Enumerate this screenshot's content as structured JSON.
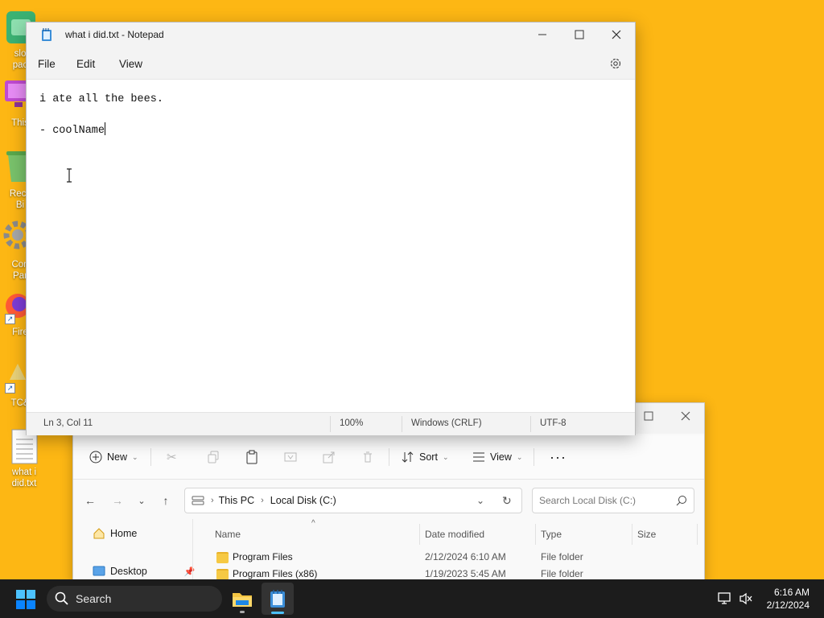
{
  "desktop": {
    "icons": [
      {
        "label": "slo\npac",
        "icon": "folder-app-icon"
      },
      {
        "label": "This",
        "icon": "this-pc-icon"
      },
      {
        "label": "Recy\nBi",
        "icon": "recycle-bin-icon"
      },
      {
        "label": "Con\nPar",
        "icon": "control-panel-icon"
      },
      {
        "label": "Fire",
        "icon": "firefox-icon"
      },
      {
        "label": "TC&",
        "icon": "shortcut-icon"
      },
      {
        "label": "what i\ndid.txt",
        "icon": "text-file-icon"
      }
    ]
  },
  "notepad": {
    "title": "what i did.txt - Notepad",
    "menu": {
      "file": "File",
      "edit": "Edit",
      "view": "View"
    },
    "content": {
      "line1": "i ate all the bees.",
      "line3": "- coolName"
    },
    "status": {
      "position": "Ln 3, Col 11",
      "zoom": "100%",
      "line_ending": "Windows (CRLF)",
      "encoding": "UTF-8"
    }
  },
  "explorer": {
    "toolbar": {
      "new": "New",
      "sort": "Sort",
      "view": "View"
    },
    "address": {
      "root": "This PC",
      "current": "Local Disk (C:)"
    },
    "search_placeholder": "Search Local Disk (C:)",
    "nav": {
      "home": "Home",
      "desktop": "Desktop"
    },
    "columns": {
      "name": "Name",
      "date": "Date modified",
      "type": "Type",
      "size": "Size"
    },
    "files": [
      {
        "name": "Program Files",
        "date": "2/12/2024 6:10 AM",
        "type": "File folder"
      },
      {
        "name": "Program Files (x86)",
        "date": "1/19/2023 5:45 AM",
        "type": "File folder"
      }
    ]
  },
  "taskbar": {
    "search_label": "Search",
    "time": "6:16 AM",
    "date": "2/12/2024"
  },
  "colors": {
    "desktop_bg": "#fdb714",
    "taskbar_bg": "#1c1c1c",
    "accent": "#0067c0"
  }
}
